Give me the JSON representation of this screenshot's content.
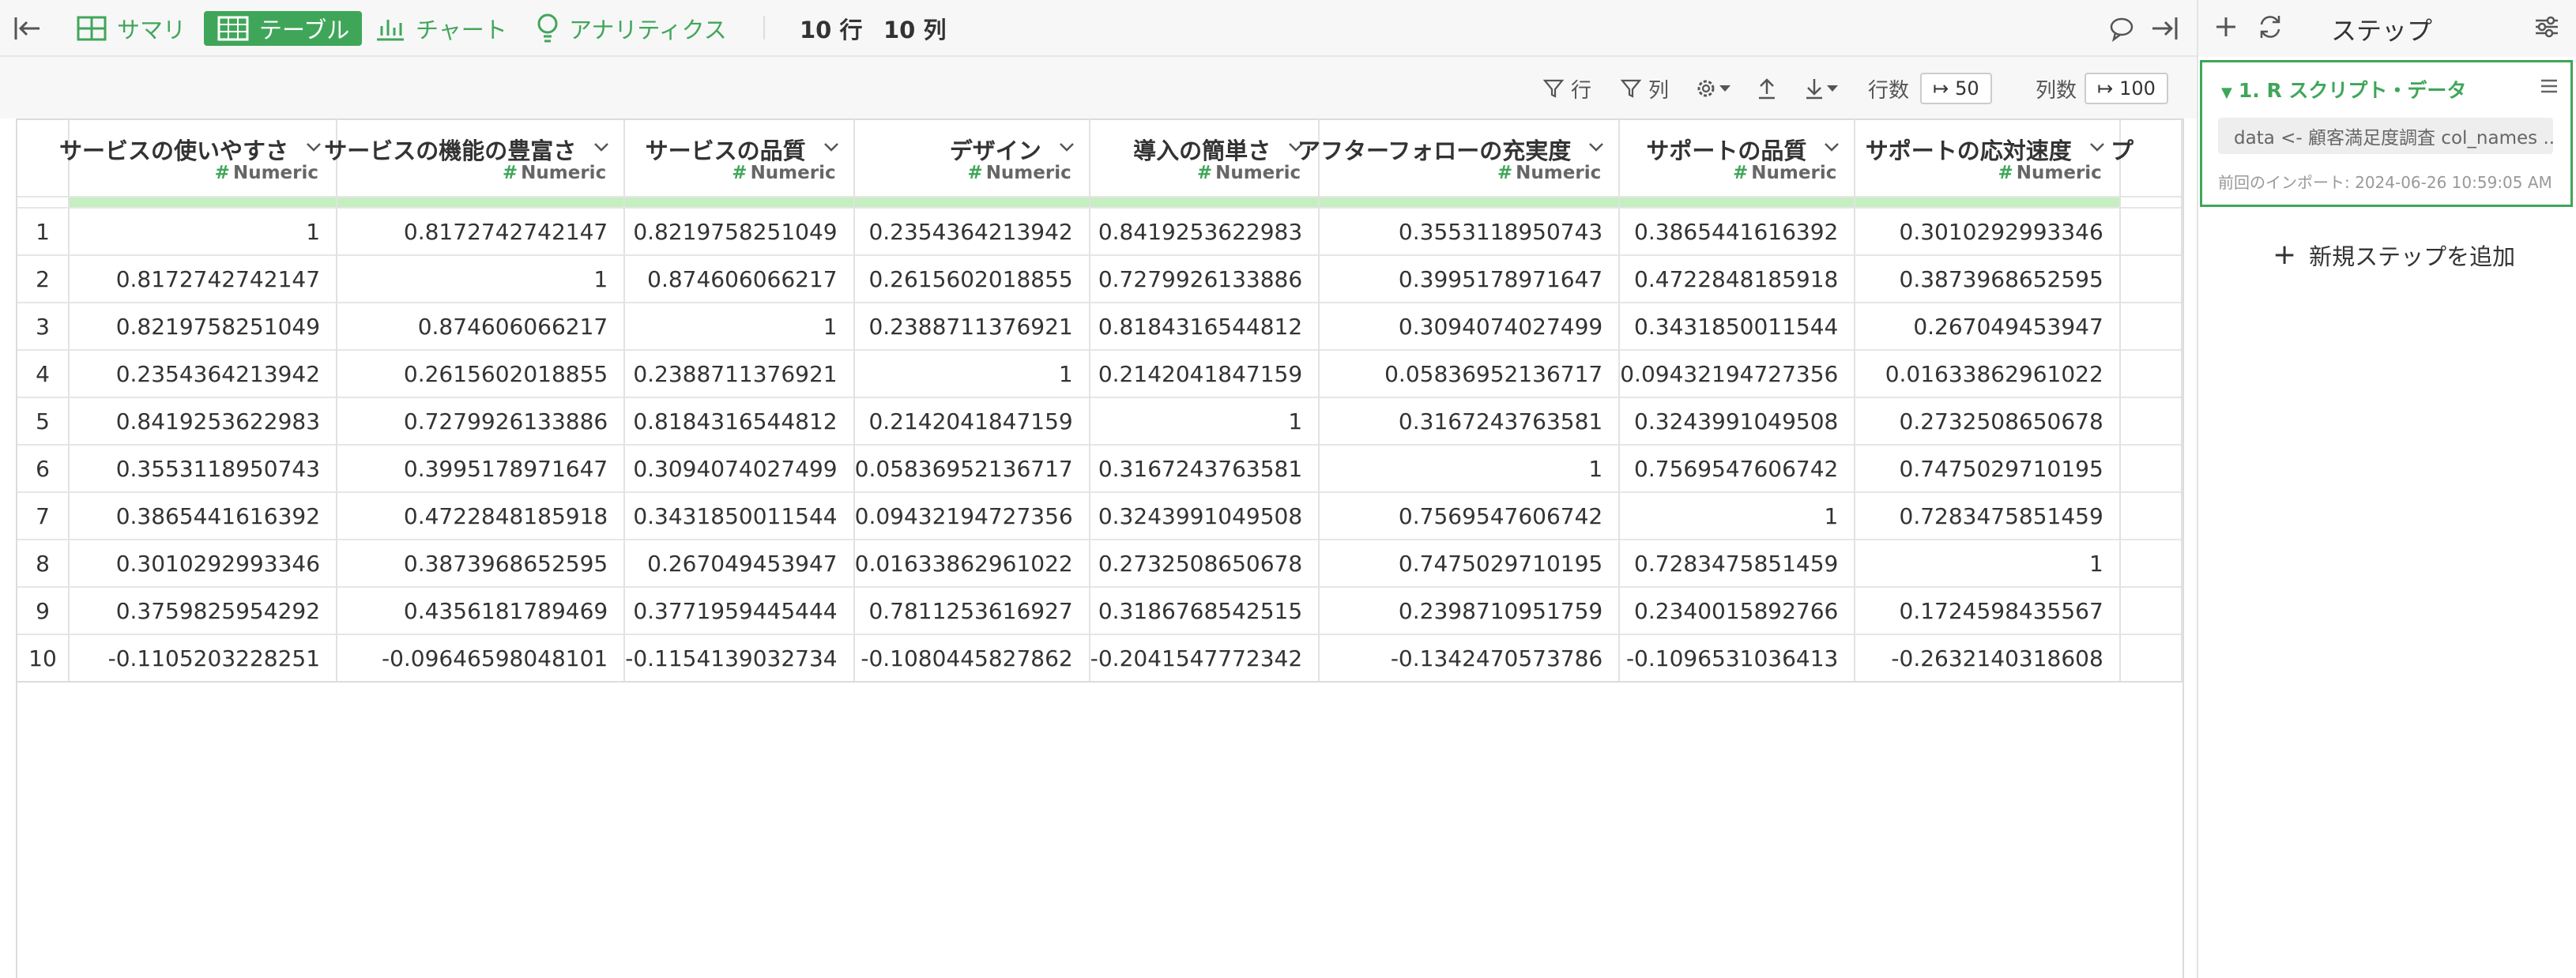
{
  "topbar": {
    "tabs": [
      {
        "label": "サマリ"
      },
      {
        "label": "テーブル"
      },
      {
        "label": "チャート"
      },
      {
        "label": "アナリティクス"
      }
    ],
    "row_count": "10 行",
    "col_count": "10 列"
  },
  "toolbar": {
    "row_filter": "行",
    "col_filter": "列",
    "rows_label": "行数",
    "rows_value": "50",
    "cols_label": "列数",
    "cols_value": "100"
  },
  "table": {
    "columns": [
      {
        "name": "サービスの使いやすさ",
        "type": "Numeric"
      },
      {
        "name": "サービスの機能の豊富さ",
        "type": "Numeric"
      },
      {
        "name": "サービスの品質",
        "type": "Numeric"
      },
      {
        "name": "デザイン",
        "type": "Numeric"
      },
      {
        "name": "導入の簡単さ",
        "type": "Numeric"
      },
      {
        "name": "アフターフォローの充実度",
        "type": "Numeric"
      },
      {
        "name": "サポートの品質",
        "type": "Numeric"
      },
      {
        "name": "サポートの応対速度",
        "type": "Numeric"
      },
      {
        "name": "プ",
        "type": ""
      }
    ],
    "rows": [
      {
        "idx": "1",
        "cells": [
          "1",
          "0.8172742742147",
          "0.8219758251049",
          "0.2354364213942",
          "0.8419253622983",
          "0.3553118950743",
          "0.3865441616392",
          "0.3010292993346",
          ""
        ]
      },
      {
        "idx": "2",
        "cells": [
          "0.8172742742147",
          "1",
          "0.874606066217",
          "0.2615602018855",
          "0.7279926133886",
          "0.3995178971647",
          "0.4722848185918",
          "0.3873968652595",
          ""
        ]
      },
      {
        "idx": "3",
        "cells": [
          "0.8219758251049",
          "0.874606066217",
          "1",
          "0.2388711376921",
          "0.8184316544812",
          "0.3094074027499",
          "0.3431850011544",
          "0.267049453947",
          ""
        ]
      },
      {
        "idx": "4",
        "cells": [
          "0.2354364213942",
          "0.2615602018855",
          "0.2388711376921",
          "1",
          "0.2142041847159",
          "0.05836952136717",
          "0.09432194727356",
          "0.01633862961022",
          ""
        ]
      },
      {
        "idx": "5",
        "cells": [
          "0.8419253622983",
          "0.7279926133886",
          "0.8184316544812",
          "0.2142041847159",
          "1",
          "0.3167243763581",
          "0.3243991049508",
          "0.2732508650678",
          ""
        ]
      },
      {
        "idx": "6",
        "cells": [
          "0.3553118950743",
          "0.3995178971647",
          "0.3094074027499",
          "0.05836952136717",
          "0.3167243763581",
          "1",
          "0.7569547606742",
          "0.7475029710195",
          ""
        ]
      },
      {
        "idx": "7",
        "cells": [
          "0.3865441616392",
          "0.4722848185918",
          "0.3431850011544",
          "0.09432194727356",
          "0.3243991049508",
          "0.7569547606742",
          "1",
          "0.7283475851459",
          ""
        ]
      },
      {
        "idx": "8",
        "cells": [
          "0.3010292993346",
          "0.3873968652595",
          "0.267049453947",
          "0.01633862961022",
          "0.2732508650678",
          "0.7475029710195",
          "0.7283475851459",
          "1",
          ""
        ]
      },
      {
        "idx": "9",
        "cells": [
          "0.3759825954292",
          "0.4356181789469",
          "0.3771959445444",
          "0.7811253616927",
          "0.3186768542515",
          "0.2398710951759",
          "0.2340015892766",
          "0.1724598435567",
          ""
        ]
      },
      {
        "idx": "10",
        "cells": [
          "-0.1105203228251",
          "-0.09646598048101",
          "-0.1154139032734",
          "-0.1080445827862",
          "-0.2041547772342",
          "-0.1342470573786",
          "-0.1096531036413",
          "-0.2632140318608",
          ""
        ]
      }
    ]
  },
  "steps_panel": {
    "title": "ステップ",
    "step": {
      "name": "1. R スクリプト・データ",
      "code": "data <- 顧客満足度調査 col_names ...",
      "imported": "前回のインポート: 2024-06-26 10:59:05 AM"
    },
    "add_step": "新規ステップを追加"
  },
  "colors": {
    "accent": "#3fa659",
    "header_bar": "#c5efc0",
    "toolbar_bg": "#f7f7f7"
  }
}
